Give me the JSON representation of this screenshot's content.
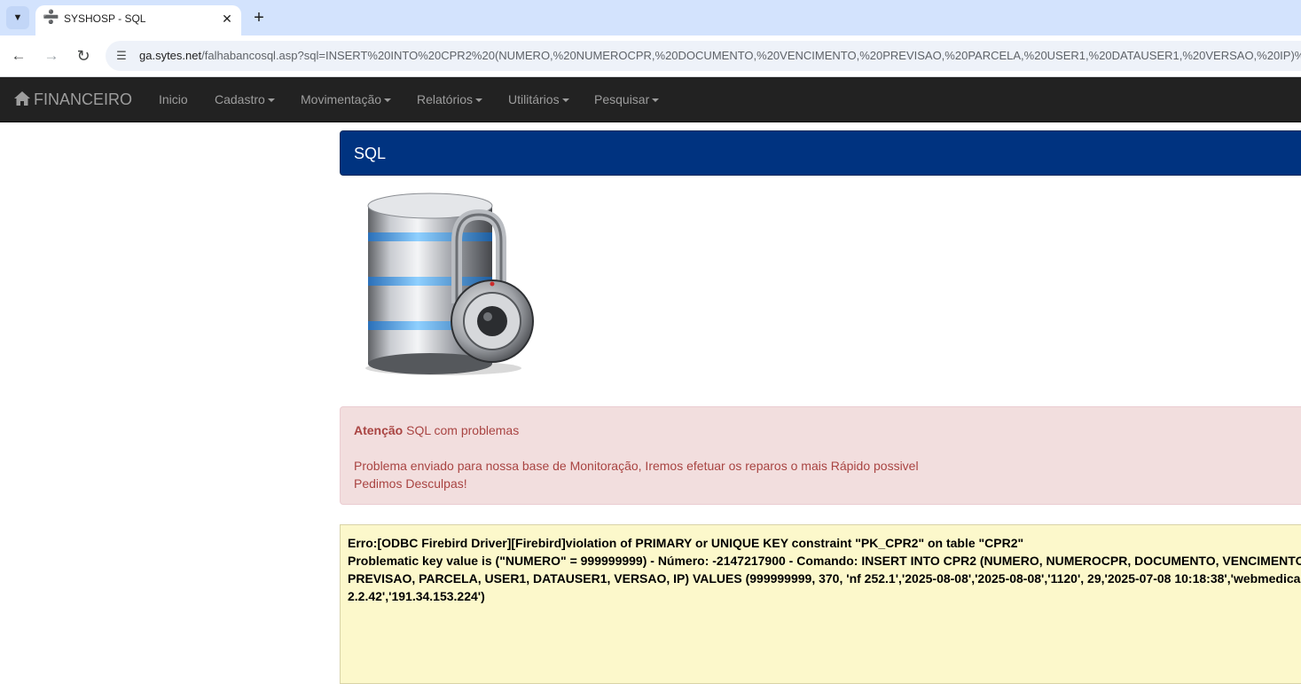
{
  "browser": {
    "tab_title": "SYSHOSP - SQL",
    "url_host": "ga.sytes.net",
    "url_rest": "/falhabancosql.asp?sql=INSERT%20INTO%20CPR2%20(NUMERO,%20NUMEROCPR,%20DOCUMENTO,%20VENCIMENTO,%20PREVISAO,%20PARCELA,%20USER1,%20DATAUSER1,%20VERSAO,%20IP)%2"
  },
  "navbar": {
    "brand": "FINANCEIRO",
    "items": [
      {
        "label": "Inicio",
        "dropdown": false
      },
      {
        "label": "Cadastro",
        "dropdown": true
      },
      {
        "label": "Movimentação",
        "dropdown": true
      },
      {
        "label": "Relatórios",
        "dropdown": true
      },
      {
        "label": "Utilitários",
        "dropdown": true
      },
      {
        "label": "Pesquisar",
        "dropdown": true
      }
    ]
  },
  "panel": {
    "title": "SQL"
  },
  "alert": {
    "strong": "Atenção",
    "line1_rest": " SQL com problemas",
    "line2": "Problema enviado para nossa base de Monitoração, Iremos efetuar os reparos o mais Rápido possivel",
    "line3": "Pedimos Desculpas!"
  },
  "error": {
    "lines": [
      "Erro:[ODBC Firebird Driver][Firebird]violation of PRIMARY or UNIQUE KEY constraint \"PK_CPR2\" on table \"CPR2\"",
      "Problematic key value is (\"NUMERO\" = 999999999) - Número: -2147217900 - Comando: INSERT INTO CPR2 (NUMERO, NUMEROCPR, DOCUMENTO, VENCIMENTO,",
      "PREVISAO, PARCELA, USER1, DATAUSER1, VERSAO, IP) VALUES (999999999, 370, 'nf 252.1','2025-08-08','2025-08-08','1120', 29,'2025-07-08 10:18:38','webmedica",
      "2.2.42','191.34.153.224')"
    ]
  },
  "icons": {
    "tab_search": "chevron-down-icon",
    "favicon": "syringe-icon",
    "close": "close-icon",
    "new_tab": "plus-icon",
    "back": "arrow-left-icon",
    "forward": "arrow-right-icon",
    "reload": "reload-icon",
    "site_info": "tune-icon",
    "brand": "home-icon",
    "illustration": "database-lock-icon"
  },
  "colors": {
    "navbar_bg": "#222222",
    "panel_heading_bg": "#003380",
    "alert_bg": "#f2dede",
    "alert_text": "#a94442",
    "error_box_bg": "#fcf8cb"
  }
}
